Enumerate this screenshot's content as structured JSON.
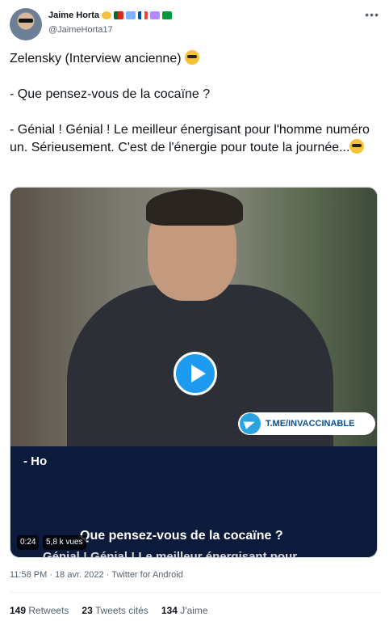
{
  "author": {
    "name": "Jaime Horta",
    "handle": "@JaimeHorta17",
    "more_label": "•••",
    "name_emoji_colors": [
      "#f7c23b",
      "#d52b1e",
      "#7fb3ff",
      "#0055a4",
      "#b58bff",
      "#009c3b"
    ]
  },
  "tweet": {
    "line1": "Zelensky (Interview ancienne)",
    "line2": "- Que pensez-vous de la cocaïne ?",
    "line3": "- Génial ! Génial ! Le meilleur énergisant pour l'homme numéro un. Sérieusement. C'est de l'énergie pour toute la journée..."
  },
  "video": {
    "telegram_label": "T.ME/INVACCINABLE",
    "subtitle_1": "- Ho",
    "subtitle_2": "Que pensez-vous de la cocaïne ?",
    "subtitle_3": "Génial ! Génial ! Le meilleur énergisant pour",
    "duration": "0:24",
    "views": "5,8 k vues"
  },
  "meta": {
    "time": "11:58 PM",
    "date": "18 avr. 2022",
    "source": "Twitter for Android"
  },
  "stats": {
    "retweets_count": "149",
    "retweets_label": "Retweets",
    "quotes_count": "23",
    "quotes_label": "Tweets cités",
    "likes_count": "134",
    "likes_label": "J'aime"
  }
}
